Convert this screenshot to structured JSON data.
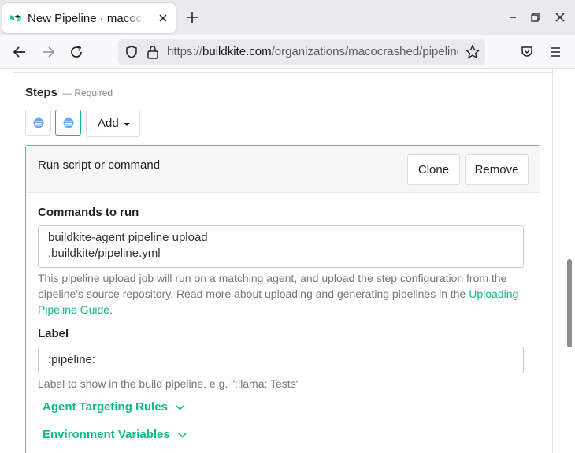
{
  "browser": {
    "tab_title": "New Pipeline · macocrashed · Buildkite",
    "url_scheme": "https://",
    "url_host": "buildkite.com",
    "url_path": "/organizations/macocrashed/pipelines/new"
  },
  "steps": {
    "title": "Steps",
    "required_note": "— Required",
    "add_label": "Add"
  },
  "step_panel": {
    "title": "Run script or command",
    "clone_label": "Clone",
    "remove_label": "Remove",
    "commands_label": "Commands to run",
    "commands": [
      "buildkite-agent pipeline upload",
      ".buildkite/pipeline.yml"
    ],
    "commands_help": "This pipeline upload job will run on a matching agent, and upload the step configuration from the pipeline's source repository. Read more about uploading and generating pipelines in the ",
    "commands_help_link": "Uploading Pipeline Guide",
    "commands_help_end": ".",
    "label_label": "Label",
    "label_value": ":pipeline:",
    "label_help": "Label to show in the build pipeline. e.g. \":llama: Tests\"",
    "agent_targeting": "Agent Targeting Rules",
    "env_vars": "Environment Variables"
  },
  "colors": {
    "accent": "#12b886",
    "panel_border": "#3ec9a5"
  }
}
